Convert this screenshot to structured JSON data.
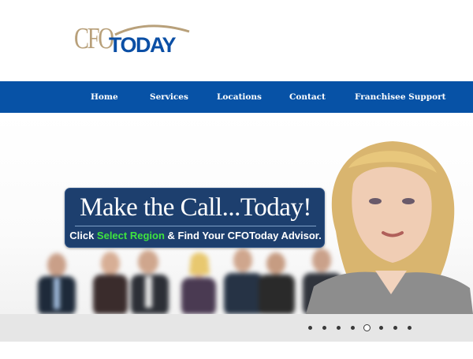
{
  "logo": {
    "cfo": "CFO",
    "today": "TODAY"
  },
  "nav": {
    "items": [
      {
        "label": "Home"
      },
      {
        "label": "Services"
      },
      {
        "label": "Locations"
      },
      {
        "label": "Contact"
      },
      {
        "label": "Franchisee Support"
      }
    ]
  },
  "hero": {
    "headline": "Make the Call...Today!",
    "sub_prefix": "Click ",
    "sub_link": "Select Region",
    "sub_suffix": " & Find Your CFOToday Advisor."
  },
  "slider": {
    "slide_count": 8,
    "active_index": 4
  },
  "colors": {
    "nav_bg": "#0752a6",
    "logo_gold": "#b8a07a",
    "logo_blue": "#0b4fa5",
    "callout_bg": "#1d3f6e",
    "highlight_green": "#3fe33f",
    "strip_bg": "#e6e6e6"
  }
}
